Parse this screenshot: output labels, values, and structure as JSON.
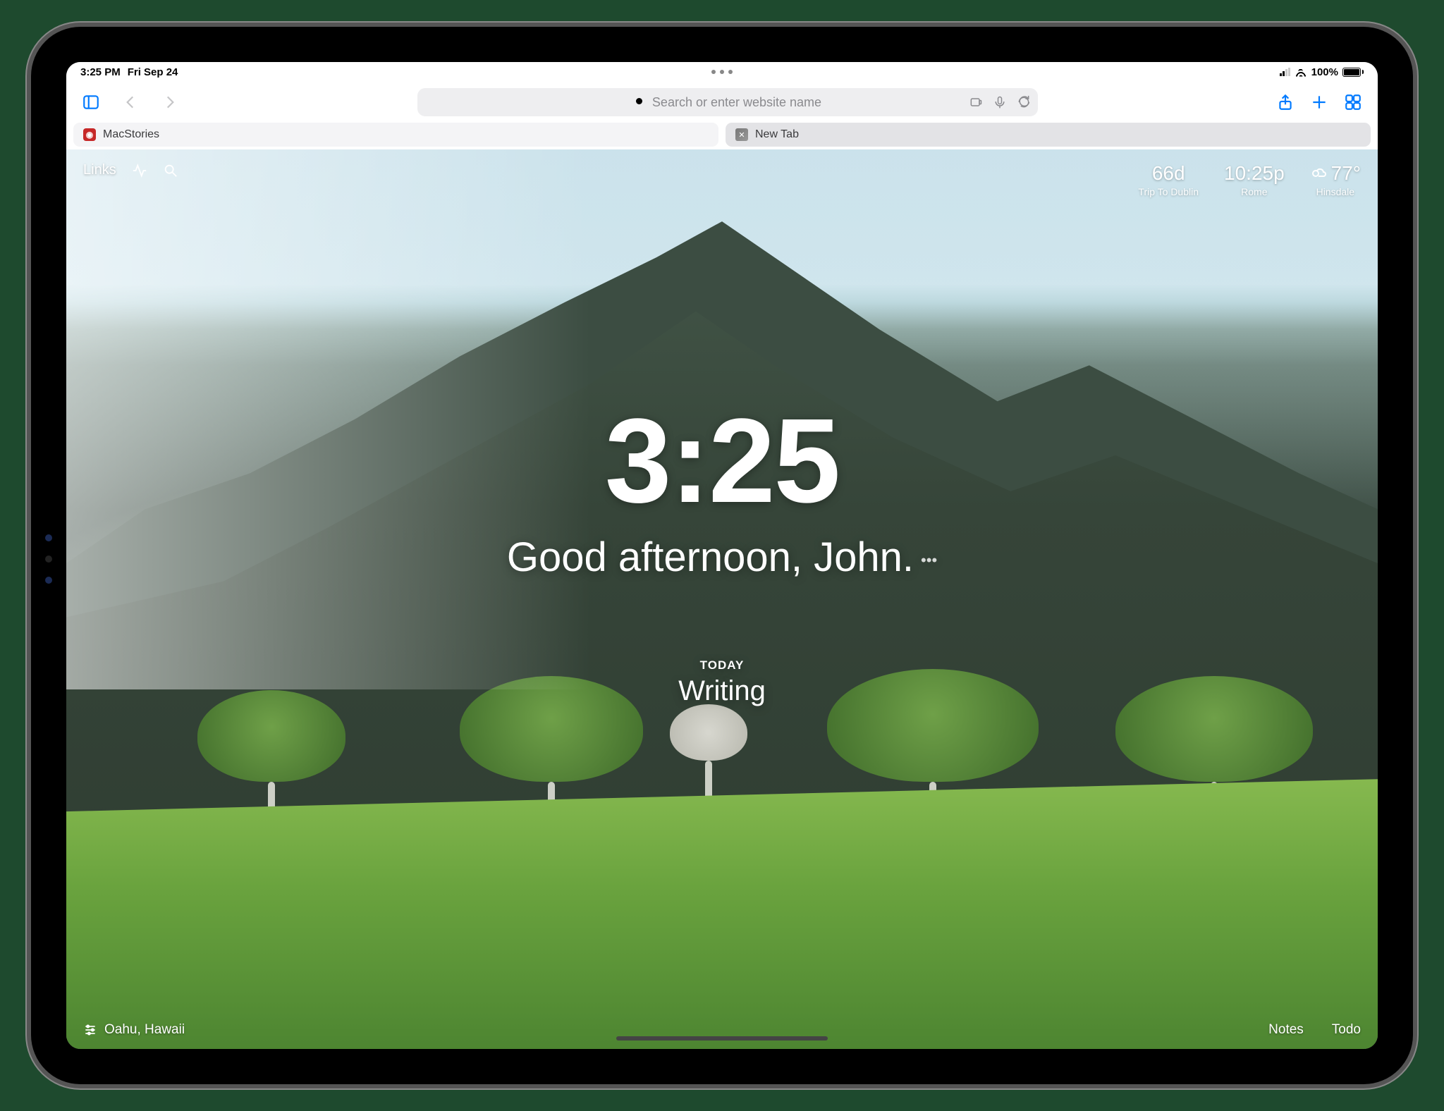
{
  "status_bar": {
    "time": "3:25 PM",
    "date": "Fri Sep 24",
    "battery_pct": "100%"
  },
  "toolbar": {
    "url_placeholder": "Search or enter website name"
  },
  "tabs": [
    {
      "label": "MacStories"
    },
    {
      "label": "New Tab"
    }
  ],
  "page": {
    "top_left": {
      "links_label": "Links"
    },
    "top_right": [
      {
        "value": "66d",
        "label": "Trip To Dublin",
        "icon": null
      },
      {
        "value": "10:25p",
        "label": "Rome",
        "icon": null
      },
      {
        "value": "77°",
        "label": "Hinsdale",
        "icon": "weather"
      }
    ],
    "clock": "3:25",
    "greeting": "Good afternoon, John.",
    "focus_label": "TODAY",
    "focus_task": "Writing",
    "location": "Oahu, Hawaii",
    "bottom_right": [
      {
        "label": "Notes"
      },
      {
        "label": "Todo"
      }
    ]
  }
}
